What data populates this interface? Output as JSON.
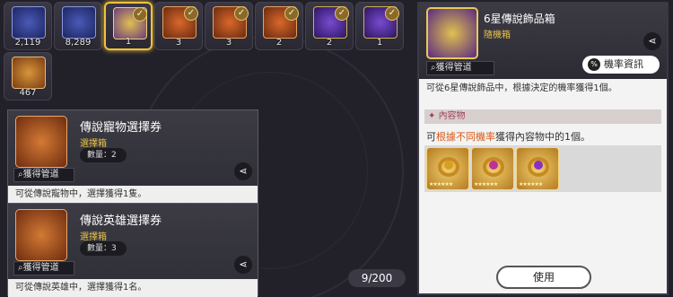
{
  "inventory": [
    {
      "art": "blue",
      "count": "2,119",
      "check": false,
      "selected": false
    },
    {
      "art": "blue",
      "count": "8,289",
      "check": false,
      "selected": false
    },
    {
      "art": "gold",
      "count": "1",
      "check": true,
      "selected": true
    },
    {
      "art": "orange",
      "count": "3",
      "check": true,
      "selected": false
    },
    {
      "art": "orange",
      "count": "3",
      "check": true,
      "selected": false
    },
    {
      "art": "orange",
      "count": "2",
      "check": true,
      "selected": false
    },
    {
      "art": "purple",
      "count": "2",
      "check": true,
      "selected": false
    },
    {
      "art": "purple",
      "count": "1",
      "check": true,
      "selected": false
    },
    {
      "art": "chest",
      "count": "467",
      "check": false,
      "selected": false
    }
  ],
  "cards": [
    {
      "title": "傳說寵物選擇券",
      "subtitle": "選擇箱",
      "quantity": "數量：2",
      "acquire": "獲得管道",
      "description": "可從傳說寵物中，選擇獲得1隻。"
    },
    {
      "title": "傳說英雄選擇券",
      "subtitle": "選擇箱",
      "quantity": "數量：3",
      "acquire": "獲得管道",
      "description": "可從傳說英雄中，選擇獲得1名。"
    }
  ],
  "counter": "9/200",
  "detail": {
    "title": "6星傳說飾品箱",
    "subtitle": "隨機箱",
    "acquire": "獲得管道",
    "rate_button": "機率資訊",
    "rate_icon": "%",
    "description": "可從6星傳說飾品中，根據決定的機率獲得1個。",
    "contents_header": "內容物",
    "contents_text_pre": "可",
    "contents_text_highlight": "根據不同機率",
    "contents_text_post": "獲得內容物中的1個。",
    "rewards": [
      {
        "gem": "#d8a020"
      },
      {
        "gem": "#c0309a"
      },
      {
        "gem": "#8a30c0"
      }
    ],
    "stars": "★★★★★★",
    "use_button": "使用"
  }
}
